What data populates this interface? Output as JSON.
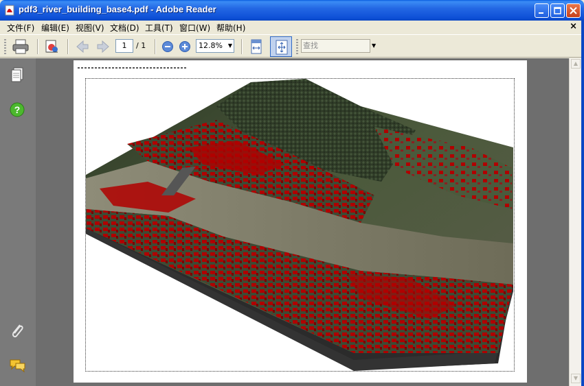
{
  "window": {
    "title": "pdf3_river_building_base4.pdf - Adobe Reader",
    "close_doc": "×"
  },
  "menu": [
    {
      "id": "file",
      "label": "文件(F)"
    },
    {
      "id": "edit",
      "label": "编辑(E)"
    },
    {
      "id": "view",
      "label": "视图(V)"
    },
    {
      "id": "document",
      "label": "文档(D)"
    },
    {
      "id": "tools",
      "label": "工具(T)"
    },
    {
      "id": "window",
      "label": "窗口(W)"
    },
    {
      "id": "help",
      "label": "帮助(H)"
    }
  ],
  "toolbar": {
    "page_current": "1",
    "page_total": "/ 1",
    "zoom": "12.8%",
    "search_placeholder": "查找",
    "dropdown_arrow": "▼"
  },
  "icons": {
    "print": "print-icon",
    "properties": "properties-icon",
    "prev": "previous-page-icon",
    "next": "next-page-icon",
    "zoom_out": "zoom-out-icon",
    "zoom_in": "zoom-in-icon",
    "fit_width": "fit-width-icon",
    "fit_page": "fit-page-icon",
    "pages": "pages-icon",
    "help": "help-icon",
    "attachments": "paperclip-icon",
    "comments": "comments-icon"
  },
  "colors": {
    "title_bar": "#0A47C4",
    "buildings": "#B00000",
    "river": "#7C7A68",
    "terrain": "#3C4A30"
  },
  "scroll": {
    "up": "▲",
    "down": "▼"
  }
}
